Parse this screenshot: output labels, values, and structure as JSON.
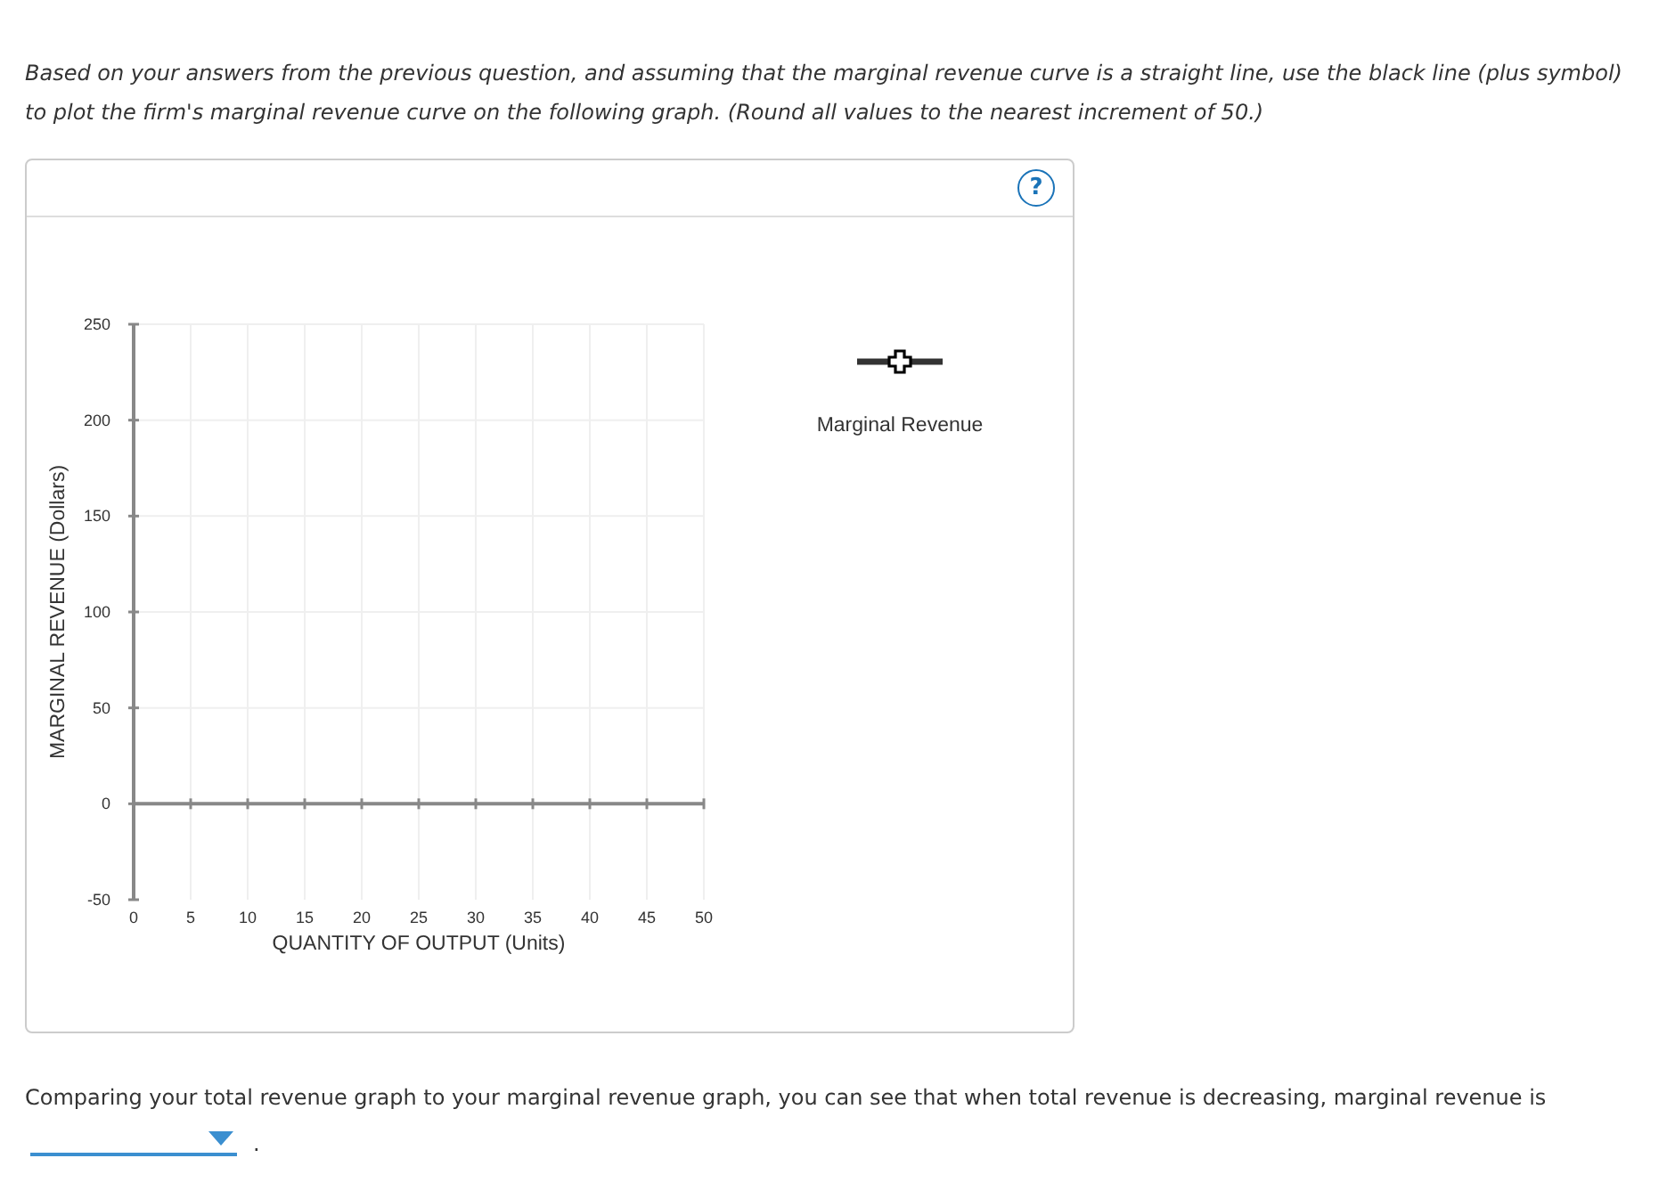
{
  "instructions": "Based on your answers from the previous question, and assuming that the marginal revenue curve is a straight line, use the black line (plus symbol) to plot the firm's marginal revenue curve on the following graph. (Round all values to the nearest increment of 50.)",
  "graph": {
    "help_button": "?",
    "legend": [
      {
        "label": "Marginal Revenue",
        "kind": "plus-line"
      }
    ],
    "chart_data": {
      "type": "line",
      "grid": true,
      "xlabel": "QUANTITY OF OUTPUT (Units)",
      "ylabel": "MARGINAL REVENUE (Dollars)",
      "xlim": [
        0,
        50
      ],
      "ylim": [
        -50,
        250
      ],
      "xticks": [
        0,
        5,
        10,
        15,
        20,
        25,
        30,
        35,
        40,
        45,
        50
      ],
      "yticks": [
        -50,
        0,
        50,
        100,
        150,
        200,
        250
      ]
    }
  },
  "question": "Comparing your total revenue graph to your marginal revenue graph, you can see that when total revenue is decreasing, marginal revenue is",
  "answer": {
    "kind": "dropdown",
    "trailing_text": "."
  }
}
